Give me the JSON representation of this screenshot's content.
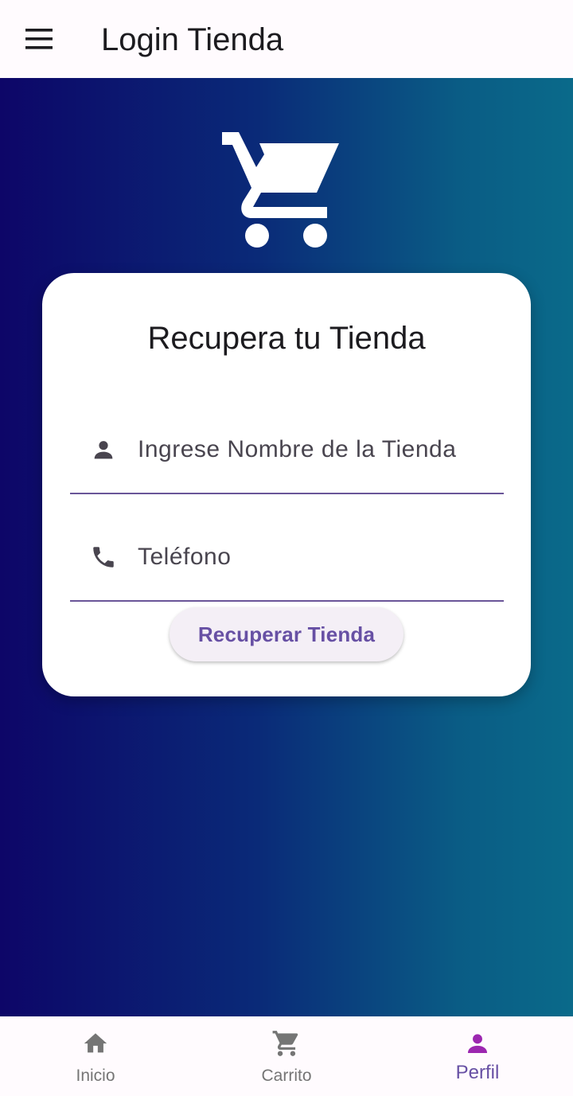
{
  "appbar": {
    "title": "Login Tienda",
    "menu_icon": "menu-icon"
  },
  "logo": {
    "icon": "shopping-cart-icon"
  },
  "card": {
    "title": "Recupera tu Tienda",
    "store_name_field": {
      "placeholder": "Ingrese Nombre de la Tienda",
      "icon": "person-icon"
    },
    "phone_field": {
      "placeholder": "Teléfono",
      "icon": "phone-icon"
    },
    "recover_button_label": "Recuperar Tienda"
  },
  "bottom_nav": {
    "items": [
      {
        "label": "Inicio",
        "icon": "home-icon",
        "active": false
      },
      {
        "label": "Carrito",
        "icon": "cart-icon",
        "active": false
      },
      {
        "label": "Perfil",
        "icon": "person-icon",
        "active": true
      }
    ]
  },
  "colors": {
    "primary": "#6750a4",
    "active_nav_icon": "#9c27b0",
    "inactive_nav": "#757575",
    "gradient_start": "#0d0668",
    "gradient_end": "#0a6a8a",
    "card_background": "#ffffff"
  }
}
